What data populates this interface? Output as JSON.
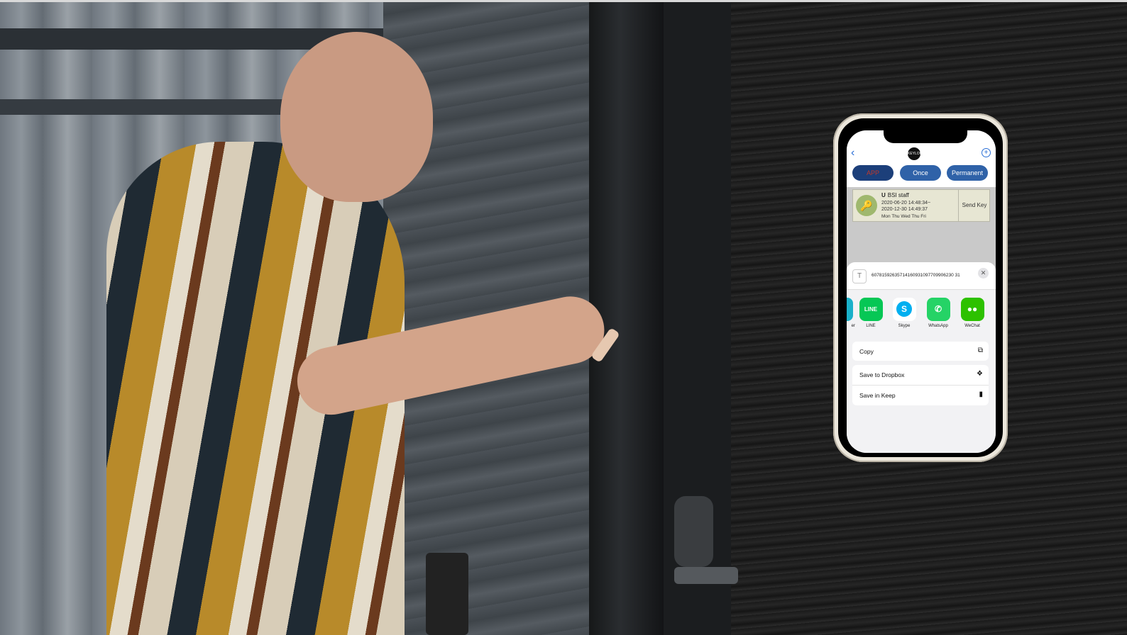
{
  "app": {
    "logo_text": "KEYLOK"
  },
  "tabs": [
    {
      "label": "APP"
    },
    {
      "label": "Once"
    },
    {
      "label": "Permanent"
    }
  ],
  "key": {
    "user_letter": "U",
    "title": "BSI staff",
    "time_start": "2020-06-20 14:48:34~",
    "time_end": "2020-12-30 14:49:37",
    "days": "Mon Thu Wed Thu Fri",
    "send_label": "Send Key"
  },
  "share": {
    "code": "60781592635714160931097709906230 31",
    "apps": [
      {
        "label": "er",
        "icon": "messenger-icon",
        "color": "#19b0c9"
      },
      {
        "label": "LINE",
        "icon": "line-icon",
        "color": "#06c755"
      },
      {
        "label": "Skype",
        "icon": "skype-icon",
        "color": "#00aff0"
      },
      {
        "label": "WhatsApp",
        "icon": "whatsapp-icon",
        "color": "#25d366"
      },
      {
        "label": "WeChat",
        "icon": "wechat-icon",
        "color": "#2dc100"
      }
    ],
    "actions": [
      {
        "label": "Copy",
        "icon": "copy-icon"
      },
      {
        "label": "Save to Dropbox",
        "icon": "dropbox-icon"
      },
      {
        "label": "Save in Keep",
        "icon": "bookmark-icon"
      }
    ]
  },
  "colors": {
    "accent": "#2f62a8",
    "app_tab": "#1c3f7a",
    "app_tab_text": "#c0392b"
  }
}
